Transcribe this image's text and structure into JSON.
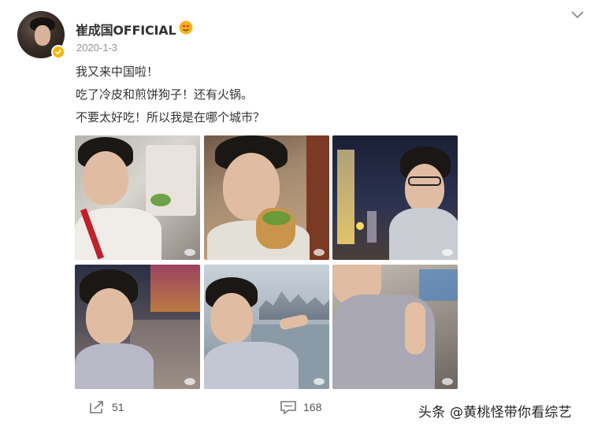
{
  "post": {
    "username": "崔成国OFFICIAL",
    "date": "2020-1-3",
    "lines": [
      "我又来中国啦！",
      "吃了冷皮和煎饼狗子！还有火锅。",
      "不要太好吃！所以我是在哪个城市？"
    ],
    "photos": [
      {
        "alt": "火锅自拍"
      },
      {
        "alt": "煎饼自拍"
      },
      {
        "alt": "夜景自拍"
      },
      {
        "alt": "步行街自拍"
      },
      {
        "alt": "江边自拍"
      },
      {
        "alt": "点赞自拍"
      }
    ]
  },
  "actions": {
    "repost_count": "51",
    "comment_count": "168"
  },
  "source_text": "头条 @黄桃怪带你看综艺",
  "colors": {
    "verified_badge": "#f7b500",
    "text": "#333333",
    "date": "#939393"
  },
  "icons": [
    "chevron-down-icon",
    "verified-icon",
    "emoji-badge-icon",
    "repost-icon",
    "comment-icon"
  ]
}
